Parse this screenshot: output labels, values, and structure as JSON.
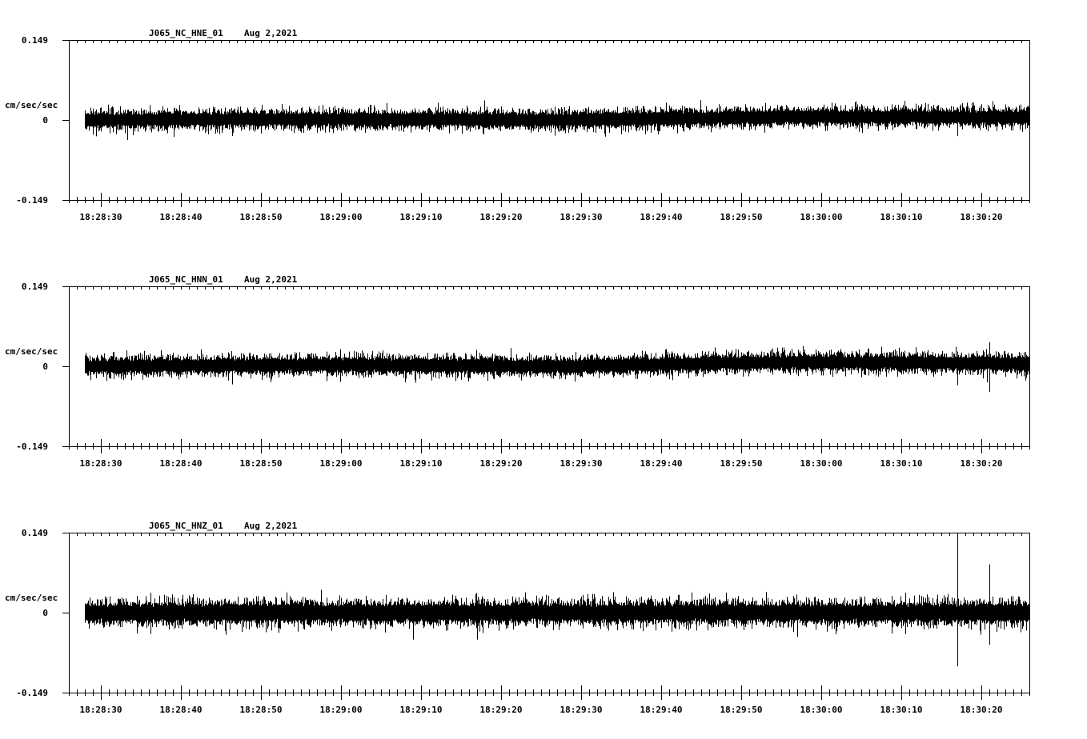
{
  "chart_data": [
    {
      "type": "line",
      "title": "J065_NC_HNE_01",
      "date": "Aug 2,2021",
      "ylabel": "cm/sec/sec",
      "ylim": [
        -0.149,
        0.149
      ],
      "y_tick_labels": [
        "0.149",
        "0",
        "-0.149"
      ],
      "x_tick_labels": [
        "18:28:30",
        "18:28:40",
        "18:28:50",
        "18:29:00",
        "18:29:10",
        "18:29:20",
        "18:29:30",
        "18:29:40",
        "18:29:50",
        "18:30:00",
        "18:30:10",
        "18:30:20"
      ],
      "xlim": [
        "18:28:26",
        "18:30:26"
      ],
      "trace_start": "18:28:28",
      "noise_amplitude": 0.011,
      "baseline_trend": [
        [
          0,
          0
        ],
        [
          0.25,
          0.002
        ],
        [
          0.5,
          0.0
        ],
        [
          0.75,
          0.006
        ],
        [
          1,
          0.005
        ]
      ],
      "spikes": [
        {
          "t": "18:30:17",
          "value": -0.03
        },
        {
          "t": "18:30:14",
          "value": 0.028
        }
      ]
    },
    {
      "type": "line",
      "title": "J065_NC_HNN_01",
      "date": "Aug 2,2021",
      "ylabel": "cm/sec/sec",
      "ylim": [
        -0.149,
        0.149
      ],
      "y_tick_labels": [
        "0.149",
        "0",
        "-0.149"
      ],
      "x_tick_labels": [
        "18:28:30",
        "18:28:40",
        "18:28:50",
        "18:29:00",
        "18:29:10",
        "18:29:20",
        "18:29:30",
        "18:29:40",
        "18:29:50",
        "18:30:00",
        "18:30:10",
        "18:30:20"
      ],
      "xlim": [
        "18:28:26",
        "18:30:26"
      ],
      "trace_start": "18:28:28",
      "noise_amplitude": 0.011,
      "baseline_trend": [
        [
          0,
          0
        ],
        [
          0.25,
          0.003
        ],
        [
          0.5,
          0.0
        ],
        [
          0.75,
          0.008
        ],
        [
          1,
          0.005
        ]
      ],
      "spikes": [
        {
          "t": "18:30:21",
          "value": 0.045
        },
        {
          "t": "18:30:21",
          "value": -0.048
        },
        {
          "t": "18:30:17",
          "value": -0.035
        },
        {
          "t": "18:29:08",
          "value": -0.03
        }
      ]
    },
    {
      "type": "line",
      "title": "J065_NC_HNZ_01",
      "date": "Aug 2,2021",
      "ylabel": "cm/sec/sec",
      "ylim": [
        -0.149,
        0.149
      ],
      "y_tick_labels": [
        "0.149",
        "0",
        "-0.149"
      ],
      "x_tick_labels": [
        "18:28:30",
        "18:28:40",
        "18:28:50",
        "18:29:00",
        "18:29:10",
        "18:29:20",
        "18:29:30",
        "18:29:40",
        "18:29:50",
        "18:30:00",
        "18:30:10",
        "18:30:20"
      ],
      "xlim": [
        "18:28:26",
        "18:30:26"
      ],
      "trace_start": "18:28:28",
      "noise_amplitude": 0.014,
      "baseline_trend": [
        [
          0,
          0
        ],
        [
          1,
          0
        ]
      ],
      "spikes": [
        {
          "t": "18:30:17",
          "value": 0.149
        },
        {
          "t": "18:30:17",
          "value": -0.1
        },
        {
          "t": "18:30:21",
          "value": 0.09
        },
        {
          "t": "18:30:21",
          "value": -0.06
        },
        {
          "t": "18:29:09",
          "value": -0.05
        },
        {
          "t": "18:29:17",
          "value": -0.05
        }
      ]
    }
  ]
}
